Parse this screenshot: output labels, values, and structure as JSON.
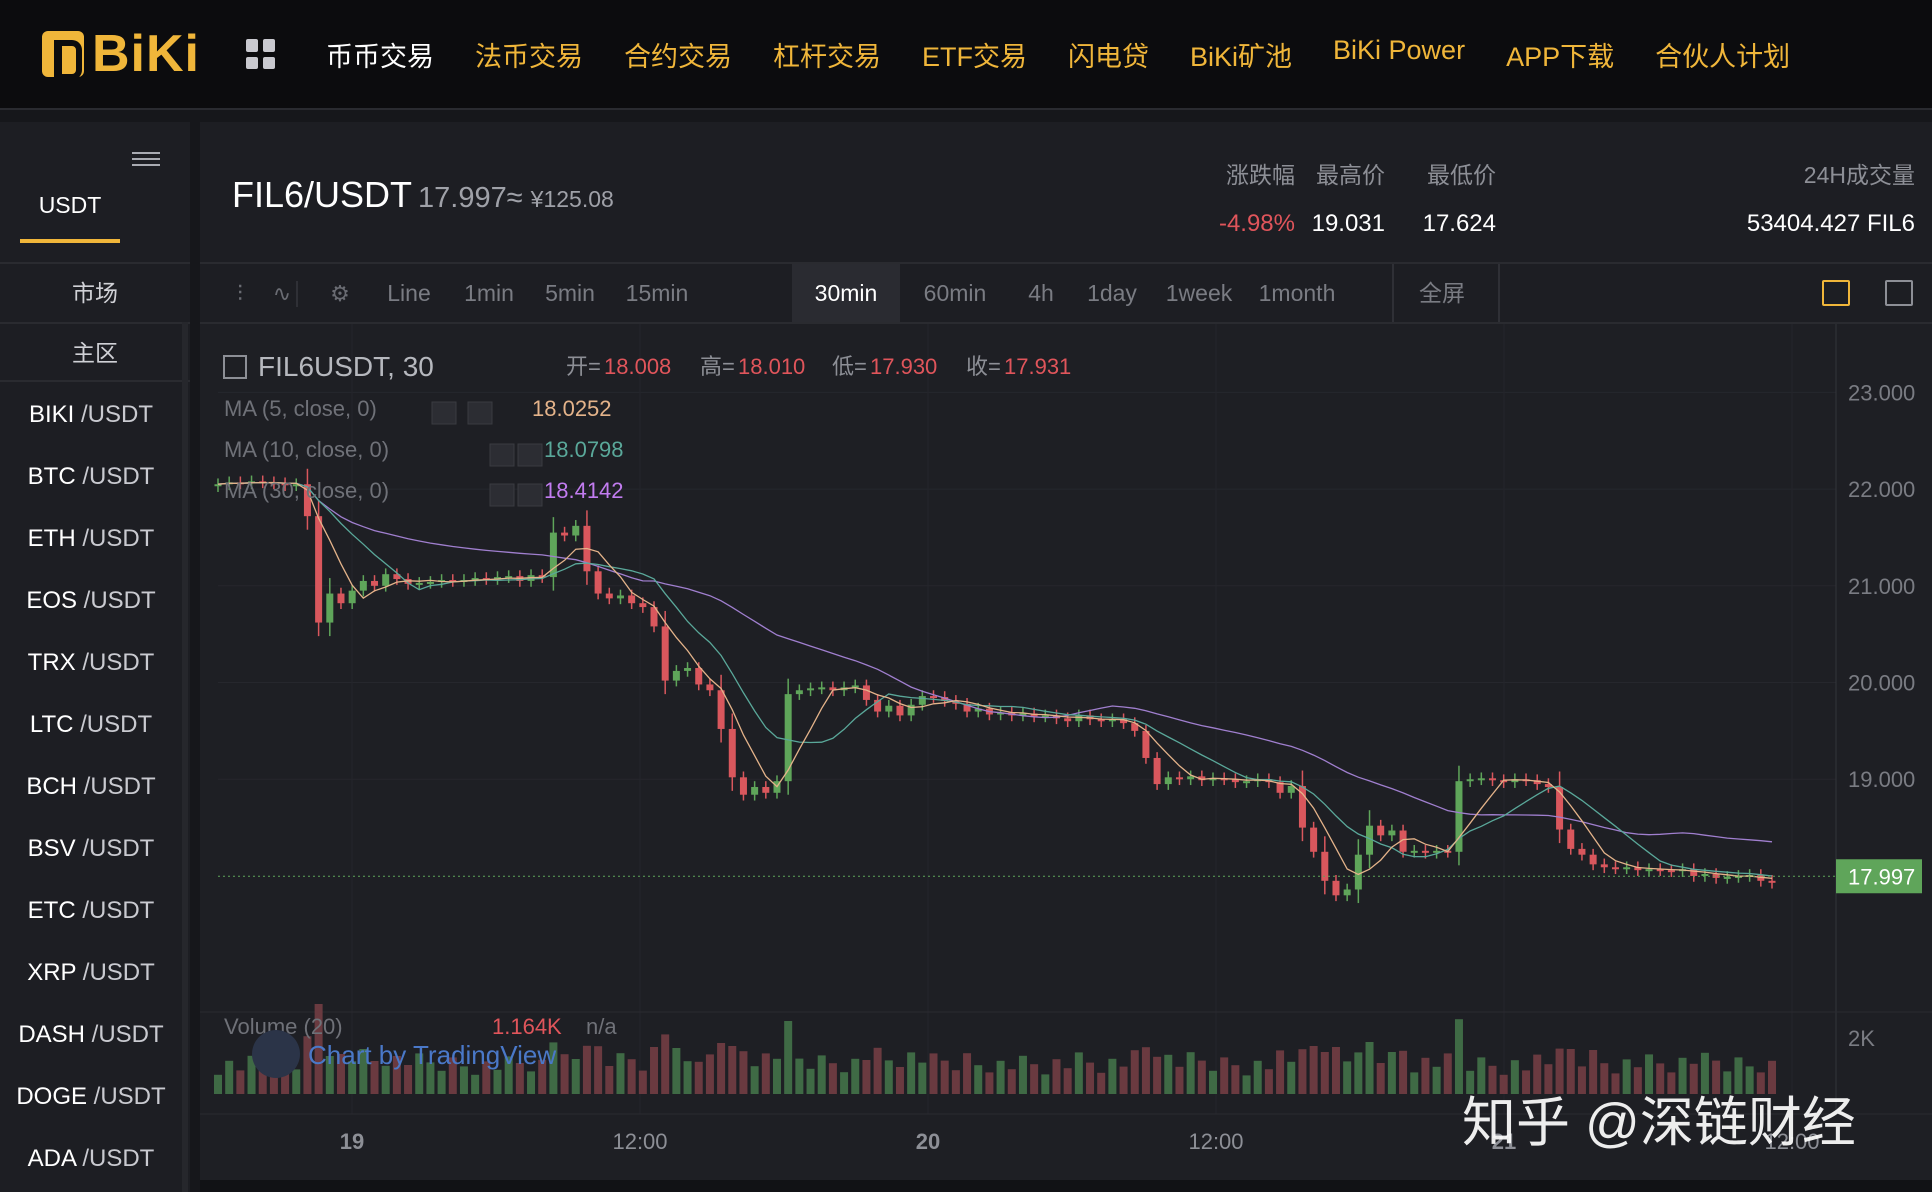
{
  "topnav": {
    "logo_text": "BiKi",
    "items": [
      "币币交易",
      "法币交易",
      "合约交易",
      "杠杆交易",
      "ETF交易",
      "闪电贷",
      "BiKi矿池",
      "BiKi Power",
      "APP下载",
      "合伙人计划"
    ]
  },
  "sidebar": {
    "quote_tab": "USDT",
    "market_label": "市场",
    "zone_label": "主区",
    "pairs": [
      {
        "base": "BIKI",
        "quote": "/USDT"
      },
      {
        "base": "BTC",
        "quote": "/USDT"
      },
      {
        "base": "ETH",
        "quote": "/USDT"
      },
      {
        "base": "EOS",
        "quote": "/USDT"
      },
      {
        "base": "TRX",
        "quote": "/USDT"
      },
      {
        "base": "LTC",
        "quote": "/USDT"
      },
      {
        "base": "BCH",
        "quote": "/USDT"
      },
      {
        "base": "BSV",
        "quote": "/USDT"
      },
      {
        "base": "ETC",
        "quote": "/USDT"
      },
      {
        "base": "XRP",
        "quote": "/USDT"
      },
      {
        "base": "DASH",
        "quote": "/USDT"
      },
      {
        "base": "DOGE",
        "quote": "/USDT"
      },
      {
        "base": "ADA",
        "quote": "/USDT"
      }
    ]
  },
  "header": {
    "pair": "FIL6/USDT",
    "price": "17.997≈",
    "cny": "¥125.08",
    "change_label": "涨跌幅",
    "change_value": "-4.98%",
    "high_label": "最高价",
    "high_value": "19.031",
    "low_label": "最低价",
    "low_value": "17.624",
    "volume_label": "24H成交量",
    "volume_value": "53404.427 FIL6"
  },
  "toolbar": {
    "intervals": [
      "Line",
      "1min",
      "5min",
      "15min",
      "30min",
      "60min",
      "4h",
      "1day",
      "1week",
      "1month"
    ],
    "active_interval": "30min",
    "fullscreen_label": "全屏"
  },
  "chart_legend": {
    "symbol": "FIL6USDT, 30",
    "open_label": "开=",
    "open": "18.008",
    "high_label": "高=",
    "high": "18.010",
    "low_label": "低=",
    "low": "17.930",
    "close_label": "收=",
    "close": "17.931",
    "ma5_label": "MA (5, close, 0)",
    "ma5_value": "18.0252",
    "ma10_label": "MA (10, close, 0)",
    "ma10_value": "18.0798",
    "ma30_label": "MA (30, close, 0)",
    "ma30_value": "18.4142",
    "volume_label": "Volume (20)",
    "volume_value": "1.164K",
    "volume_na": "n/a",
    "attribution": "Chart by TradingView"
  },
  "chart_data": {
    "type": "candlestick",
    "interval": "30min",
    "price_axis": {
      "ticks": [
        "23.000",
        "22.000",
        "21.000",
        "20.000",
        "19.000"
      ],
      "ylim": [
        17.4,
        23.5
      ]
    },
    "last_price_label": "17.997",
    "volume_axis": {
      "ticks": [
        "2K"
      ]
    },
    "time_axis": {
      "ticks": [
        "19",
        "12:00",
        "20",
        "12:00",
        "21",
        "12:00"
      ]
    },
    "closes": [
      22.05,
      22.07,
      22.06,
      22.08,
      22.07,
      22.06,
      22.04,
      22.05,
      21.72,
      20.62,
      20.92,
      20.82,
      20.95,
      21.05,
      21.0,
      21.12,
      21.07,
      21.02,
      21.03,
      21.04,
      21.06,
      21.05,
      21.06,
      21.08,
      21.07,
      21.09,
      21.1,
      21.05,
      21.11,
      21.09,
      21.55,
      21.52,
      21.62,
      21.15,
      20.92,
      20.87,
      20.9,
      20.82,
      20.78,
      20.58,
      20.02,
      20.12,
      20.15,
      19.98,
      19.92,
      19.52,
      19.02,
      18.84,
      18.92,
      18.86,
      18.98,
      19.88,
      19.92,
      19.94,
      19.95,
      19.92,
      19.95,
      19.97,
      19.82,
      19.7,
      19.76,
      19.66,
      19.77,
      19.86,
      19.85,
      19.81,
      19.78,
      19.7,
      19.73,
      19.67,
      19.69,
      19.66,
      19.68,
      19.65,
      19.66,
      19.63,
      19.6,
      19.66,
      19.62,
      19.6,
      19.62,
      19.58,
      19.5,
      19.22,
      18.95,
      19.02,
      19.0,
      19.03,
      18.99,
      19.01,
      19.0,
      18.97,
      18.98,
      19.0,
      18.97,
      18.86,
      18.93,
      18.5,
      18.25,
      17.95,
      17.8,
      17.86,
      18.22,
      18.52,
      18.42,
      18.47,
      18.25,
      18.26,
      18.24,
      18.26,
      18.25,
      18.98,
      19.0,
      19.01,
      18.99,
      18.97,
      19.0,
      18.99,
      18.95,
      18.92,
      18.48,
      18.28,
      18.22,
      18.12,
      18.09,
      18.08,
      18.09,
      18.06,
      18.07,
      18.06,
      18.05,
      18.07,
      18.0,
      18.02,
      17.98,
      17.99,
      18.0,
      18.01,
      17.95,
      17.93
    ]
  }
}
